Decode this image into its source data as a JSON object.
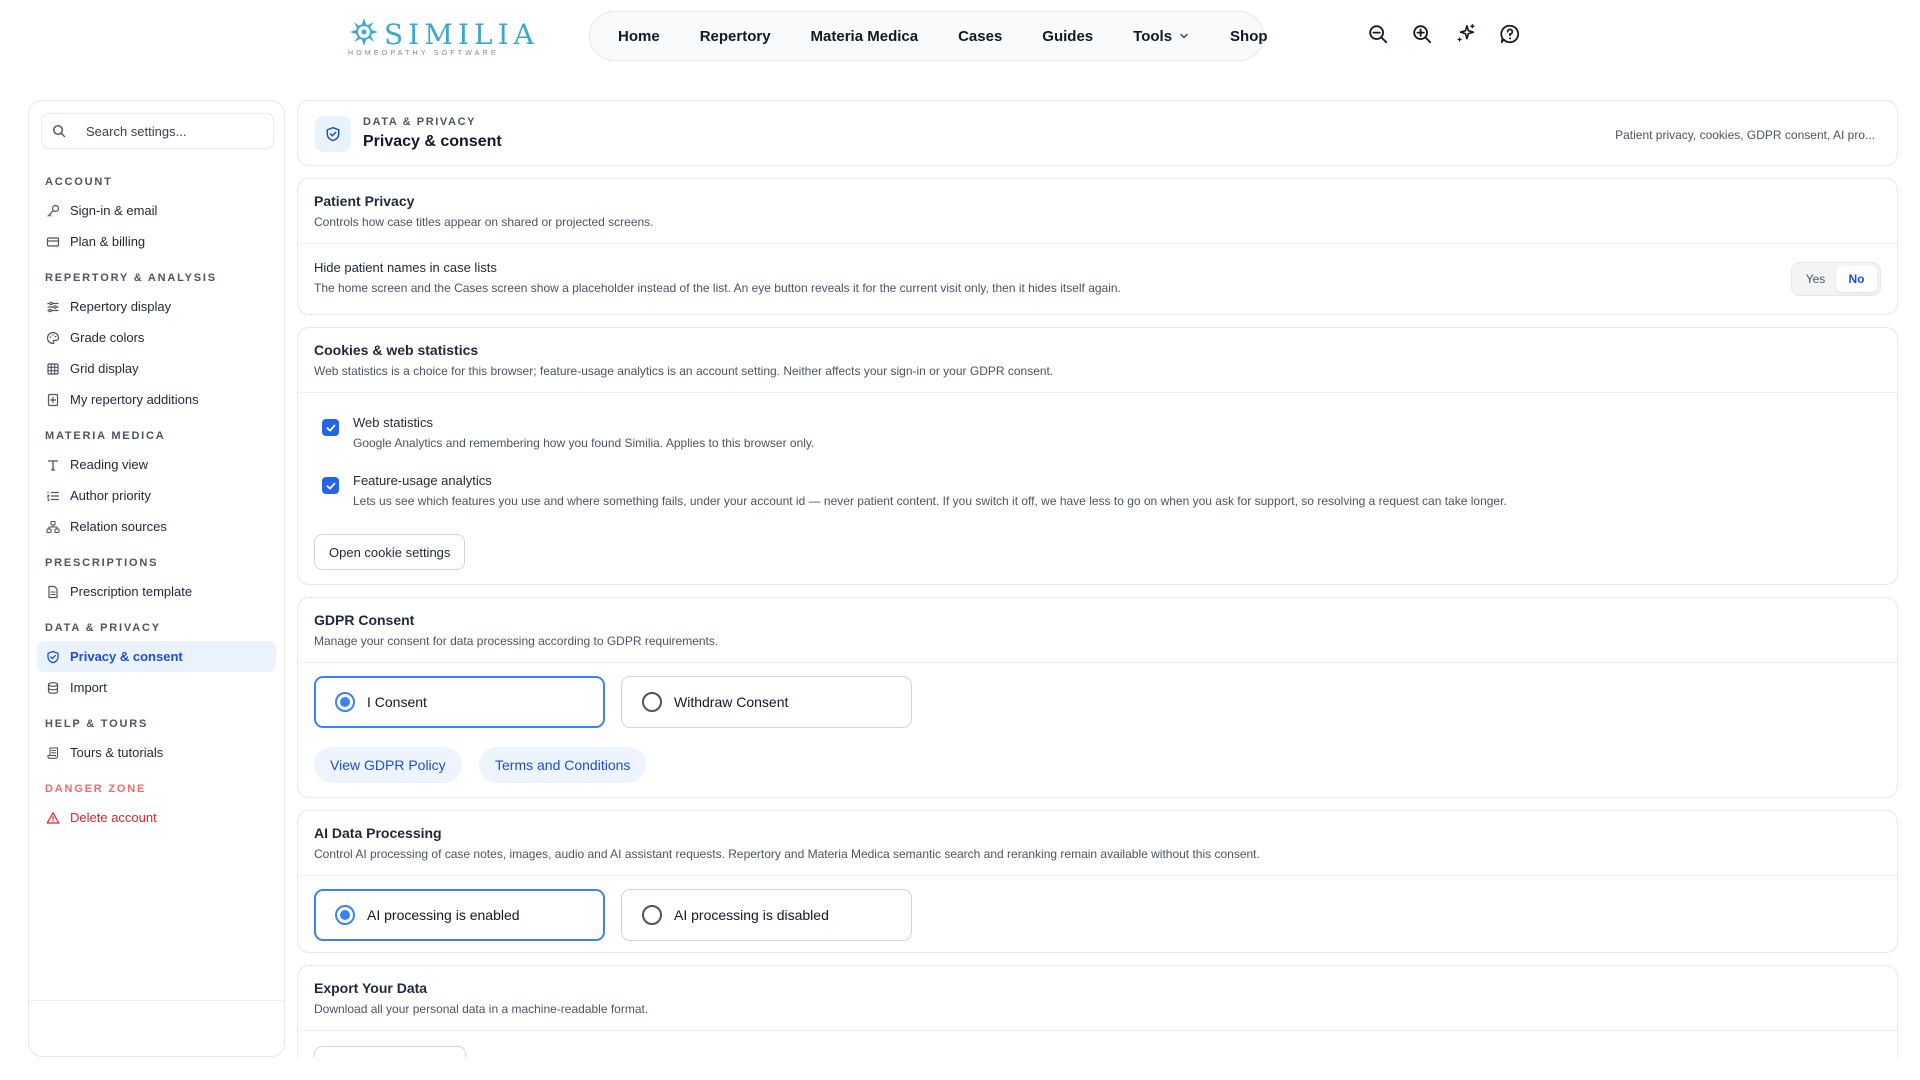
{
  "brand": {
    "name": "SIMILIA",
    "tagline": "HOMEOPATHY SOFTWARE",
    "accent": "#3aa8cf"
  },
  "nav": {
    "items": [
      {
        "label": "Home"
      },
      {
        "label": "Repertory"
      },
      {
        "label": "Materia Medica"
      },
      {
        "label": "Cases"
      },
      {
        "label": "Guides"
      },
      {
        "label": "Tools",
        "has_dropdown": true
      },
      {
        "label": "Shop"
      }
    ],
    "icons": [
      "zoom-out-icon",
      "zoom-in-icon",
      "ai-sparkle-icon",
      "help-icon"
    ]
  },
  "sidebar": {
    "search_placeholder": "Search settings...",
    "groups": [
      {
        "title": "ACCOUNT",
        "items": [
          {
            "label": "Sign-in & email",
            "icon": "key-icon"
          },
          {
            "label": "Plan & billing",
            "icon": "credit-card-icon"
          }
        ]
      },
      {
        "title": "REPERTORY & ANALYSIS",
        "items": [
          {
            "label": "Repertory display",
            "icon": "sliders-icon"
          },
          {
            "label": "Grade colors",
            "icon": "palette-icon"
          },
          {
            "label": "Grid display",
            "icon": "grid-icon"
          },
          {
            "label": "My repertory additions",
            "icon": "book-plus-icon"
          }
        ]
      },
      {
        "title": "MATERIA MEDICA",
        "items": [
          {
            "label": "Reading view",
            "icon": "type-icon"
          },
          {
            "label": "Author priority",
            "icon": "list-ordered-icon"
          },
          {
            "label": "Relation sources",
            "icon": "network-icon"
          }
        ]
      },
      {
        "title": "PRESCRIPTIONS",
        "items": [
          {
            "label": "Prescription template",
            "icon": "file-text-icon"
          }
        ]
      },
      {
        "title": "DATA & PRIVACY",
        "items": [
          {
            "label": "Privacy & consent",
            "icon": "shield-check-icon",
            "active": true
          },
          {
            "label": "Import",
            "icon": "database-icon"
          }
        ]
      },
      {
        "title": "HELP & TOURS",
        "items": [
          {
            "label": "Tours & tutorials",
            "icon": "scroll-icon"
          }
        ]
      },
      {
        "title": "DANGER ZONE",
        "danger": true,
        "items": [
          {
            "label": "Delete account",
            "icon": "warning-icon",
            "danger": true
          }
        ]
      }
    ]
  },
  "header": {
    "kicker": "DATA & PRIVACY",
    "title": "Privacy & consent",
    "summary": "Patient privacy, cookies, GDPR consent, AI pro..."
  },
  "patient_privacy": {
    "title": "Patient Privacy",
    "description": "Controls how case titles appear on shared or projected screens.",
    "setting_title": "Hide patient names in case lists",
    "setting_desc": "The home screen and the Cases screen show a placeholder instead of the list. An eye button reveals it for the current visit only, then it hides itself again.",
    "yes_label": "Yes",
    "no_label": "No",
    "selected": "No"
  },
  "cookies": {
    "title": "Cookies & web statistics",
    "description": "Web statistics is a choice for this browser; feature-usage analytics is an account setting. Neither affects your sign-in or your GDPR consent.",
    "web_stats": {
      "title": "Web statistics",
      "desc": "Google Analytics and remembering how you found Similia. Applies to this browser only.",
      "checked": true
    },
    "feature_usage": {
      "title": "Feature-usage analytics",
      "desc": "Lets us see which features you use and where something fails, under your account id — never patient content. If you switch it off, we have less to go on when you ask for support, so resolving a request can take longer.",
      "checked": true
    },
    "button": "Open cookie settings"
  },
  "gdpr": {
    "title": "GDPR Consent",
    "description": "Manage your consent for data processing according to GDPR requirements.",
    "consent_label": "I Consent",
    "withdraw_label": "Withdraw Consent",
    "selected": "I Consent",
    "policy_link": "View GDPR Policy",
    "terms_link": "Terms and Conditions"
  },
  "ai": {
    "title": "AI Data Processing",
    "description": "Control AI processing of case notes, images, audio and AI assistant requests. Repertory and Materia Medica semantic search and reranking remain available without this consent.",
    "enabled_label": "AI processing is enabled",
    "disabled_label": "AI processing is disabled",
    "selected": "AI processing is enabled"
  },
  "export": {
    "title": "Export Your Data",
    "description": "Download all your personal data in a machine-readable format."
  },
  "colors": {
    "primary": "#2563eb",
    "active_bg": "#eaf3fd",
    "danger": "#dc2626",
    "border": "#e5e7eb"
  }
}
